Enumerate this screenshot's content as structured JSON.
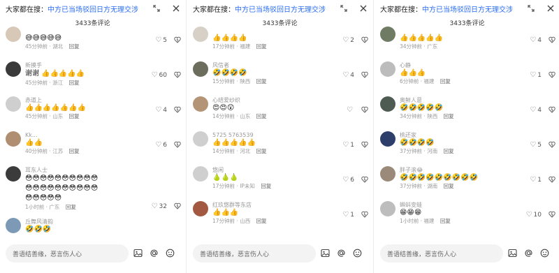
{
  "panels": [
    {
      "topbar": {
        "lead": "大家都在搜：",
        "query": "中方已当场驳回日方无理交涉"
      },
      "count": "3433条评论",
      "input_placeholder": "善语结善缘，恶言伤人心",
      "comments": [
        {
          "name": "",
          "text": "",
          "emojis": "😅😅😅😅😅",
          "meta": "45分钟前 · 湖北",
          "reply": "回复",
          "likes": "5",
          "avatar_color": "#d7c8b8"
        },
        {
          "name": "新摸手",
          "text": "谢谢",
          "emojis": "👍👍👍👍👍",
          "meta": "45分钟前 · 浙江",
          "reply": "回复",
          "likes": "60",
          "avatar_color": "#3a3a3a"
        },
        {
          "name": "赤道上",
          "text": "",
          "emojis": "👍👍👍👍👍👍👍",
          "meta": "45分钟前 · 山东",
          "reply": "回复",
          "likes": "4",
          "avatar_color": "#cfcfcf"
        },
        {
          "name": "Kk...",
          "text": "",
          "emojis": "👍👍",
          "meta": "40分钟前 · 江苏",
          "reply": "回复",
          "likes": "6",
          "avatar_color": "#b08e72"
        },
        {
          "name": "耳东人士",
          "text": "",
          "emojis": "😳😳😳😳😳😳😳😳😳😳😳😳😳😳😳😳😳😳😳😳😳😳😳😳😳",
          "meta": "1小时前 · 广东",
          "reply": "回复",
          "likes": "32",
          "avatar_color": "#3b3b3b"
        },
        {
          "name": "丘舞风清韵",
          "text": "",
          "emojis": "🤣🤣🤣",
          "meta": "",
          "reply": "",
          "likes": "",
          "avatar_color": "#7c9ab5"
        }
      ]
    },
    {
      "topbar": {
        "lead": "大家都在搜：",
        "query": "中方已当场驳回日方无理交涉"
      },
      "count": "3433条评论",
      "input_placeholder": "善语结善缘，恶言伤人心",
      "comments": [
        {
          "name": "",
          "text": "",
          "emojis": "👍👍👍👍",
          "meta": "17分钟前 · 福建",
          "reply": "回复",
          "likes": "2",
          "avatar_color": "#d6d0c6"
        },
        {
          "name": "风信者",
          "text": "",
          "emojis": "🤣🤣🤣🤣",
          "meta": "15分钟前 · 陕西",
          "reply": "回复",
          "likes": "4",
          "avatar_color": "#6d6d5e"
        },
        {
          "name": "心结爱纱织",
          "text": "",
          "emojis": "😍😍😲",
          "meta": "14分钟前 · 山东",
          "reply": "回复",
          "likes": "",
          "avatar_color": "#b39476"
        },
        {
          "name": "5725 5763539",
          "text": "",
          "emojis": "👍👍👍👍👍",
          "meta": "14分钟前 · 河北",
          "reply": "回复",
          "likes": "1",
          "avatar_color": "#cfcfcf"
        },
        {
          "name": "悠闲",
          "text": "",
          "emojis": "🍐🍐🍐",
          "meta": "17分钟前 · IP未知",
          "reply": "回复",
          "likes": "6",
          "avatar_color": "#cfcfcf"
        },
        {
          "name": "红玖悠群等东店",
          "text": "",
          "emojis": "👍👍👍",
          "meta": "17分钟前 · 山西",
          "reply": "回复",
          "likes": "1",
          "avatar_color": "#a35842"
        }
      ]
    },
    {
      "topbar": {
        "lead": "大家都在搜：",
        "query": "中方已当场驳回日方无理交涉"
      },
      "count": "3433条评论",
      "input_placeholder": "善语结善缘，恶言伤人心",
      "comments": [
        {
          "name": "",
          "text": "",
          "emojis": "👍👍👍👍👍",
          "meta": "34分钟前 · 广东",
          "reply": "",
          "likes": "4",
          "avatar_color": "#6f7b62"
        },
        {
          "name": "心静",
          "text": "",
          "emojis": "👍👍👍",
          "meta": "6分钟前 · 福建",
          "reply": "回复",
          "likes": "1",
          "avatar_color": "#bcbcbc"
        },
        {
          "name": "奥鲜人意",
          "text": "",
          "emojis": "🤣🤣🤣🤣🤣",
          "meta": "34分钟前 · 陕西",
          "reply": "回复",
          "likes": "4",
          "avatar_color": "#4e5b52"
        },
        {
          "name": "桃还家",
          "text": "",
          "emojis": "🤣🤣🤣🤣",
          "meta": "37分钟前 · 河南",
          "reply": "回复",
          "likes": "5",
          "avatar_color": "#2d3e6a"
        },
        {
          "name": "胖子滚😂",
          "text": "",
          "emojis": "🤣🤣🤣🤣🤣🤣🤣🤣🤣",
          "meta": "37分钟前 · 湖南",
          "reply": "回复",
          "likes": "1",
          "avatar_color": "#9b8a7a"
        },
        {
          "name": "蝌蚪变蛙",
          "text": "",
          "emojis": "😁😁😁",
          "meta": "1小时前 · 福建",
          "reply": "回复",
          "likes": "10",
          "avatar_color": "#bdbdbd"
        }
      ]
    }
  ],
  "icons": {
    "expand": "expand-icon",
    "close": "close-icon",
    "image": "image-icon",
    "mention": "at-icon",
    "emoji": "emoji-icon",
    "like": "heart-icon",
    "dislike": "dislike-icon"
  }
}
